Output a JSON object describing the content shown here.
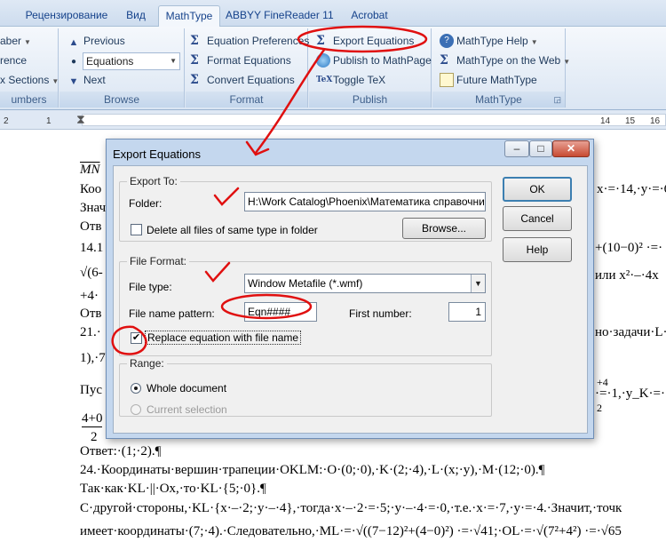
{
  "tabs": {
    "references": "Рецензирование",
    "view": "Вид",
    "mathtype": "MathType",
    "abbyy": "ABBYY FineReader 11",
    "acrobat": "Acrobat"
  },
  "ribbon": {
    "left": {
      "numbers_btn": "aber",
      "reference": "rence",
      "sections": "x Sections",
      "group_label": "umbers"
    },
    "browse": {
      "previous": "Previous",
      "combo_value": "Equations",
      "next": "Next",
      "group_label": "Browse"
    },
    "format": {
      "preferences": "Equation Preferences",
      "format_eq": "Format Equations",
      "convert_eq": "Convert Equations",
      "group_label": "Format"
    },
    "publish": {
      "export_eq": "Export Equations",
      "publish_page": "Publish to MathPage",
      "toggle_tex": "Toggle TeX",
      "group_label": "Publish"
    },
    "mathtype": {
      "help": "MathType Help",
      "on_web": "MathType on the Web",
      "future": "Future MathType",
      "group_label": "MathType"
    }
  },
  "ruler": {
    "n2": "2",
    "n1": "1",
    "n14": "14",
    "n15": "15",
    "n16": "16"
  },
  "document": {
    "l1": "MN",
    "l2": "Коо",
    "l3": "Знач",
    "l4": "Отв",
    "l5": "14.1",
    "l6": "√(6-",
    "l7": "+4·",
    "l8": "Отв",
    "l9": "21.·",
    "l10": "1),·7",
    "l11": "Пус",
    "l12a": "4+0",
    "l12b": "2",
    "r1": "x·=·14,·y·=·6",
    "r2": "+(10−0)²  ·=·",
    "r3": "или x²·–·4x",
    "r4": "но·задачи·L·(",
    "r5": "+4",
    "r6": "·=·1,·y_K·=·",
    "r7": "2",
    "a1": "Ответ:·(1;·2).¶",
    "a2": "24.·Координаты·вершин·трапеции·OKLM:·O·(0;·0),·K·(2;·4),·L·(x;·y),·M·(12;·0).¶",
    "a3": "Так·как·KL·||·Ox,·то·KL·{5;·0}.¶",
    "a4": "С·другой·стороны,·KL·{x·–·2;·y·–·4},·тогда·x·–·2·=·5;·y·–·4·=·0,·т.е.·x·=·7,·y·=·4.·Значит,·точк",
    "a5": "имеет·координаты·(7;·4).·Следовательно,·ML·=·√((7−12)²+(4−0)²)  ·=·√41;·OL·=·√(7²+4²)  ·=·√65"
  },
  "dialog": {
    "title": "Export Equations",
    "title_min": "–",
    "title_max": "□",
    "title_close": "✕",
    "export_to": "Export To:",
    "folder_label": "Folder:",
    "folder_value": "H:\\Work Catalog\\Phoenix\\Математика справочни",
    "delete_label": "Delete all files of same type in folder",
    "browse": "Browse...",
    "file_format": "File Format:",
    "file_type_label": "File type:",
    "file_type_value": "Window Metafile (*.wmf)",
    "pattern_label": "File name pattern:",
    "pattern_value": "Eqn####",
    "first_number_label": "First number:",
    "first_number_value": "1",
    "replace_label": "Replace equation with file name",
    "replace_checked": "✔",
    "range": "Range:",
    "whole_doc": "Whole document",
    "current_sel": "Current selection",
    "ok": "OK",
    "cancel": "Cancel",
    "help": "Help"
  },
  "colors": {
    "annotation_red": "#e01010",
    "ribbon_blue": "#15428b"
  }
}
